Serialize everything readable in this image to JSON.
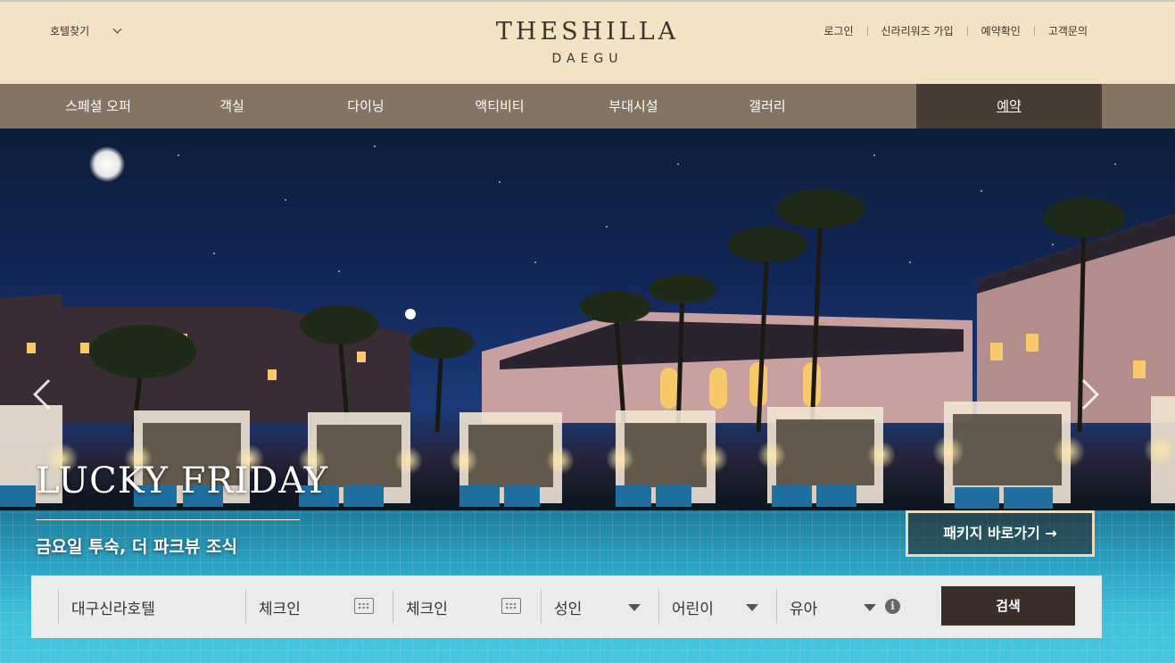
{
  "header": {
    "hotel_find": "호텔찾기",
    "logo_main": "THESHILLA",
    "logo_sub": "DAEGU",
    "util_links": [
      "로그인",
      "신라리워즈 가입",
      "예약확인",
      "고객문의"
    ]
  },
  "nav": {
    "items": [
      "스페셜 오퍼",
      "객실",
      "다이닝",
      "액티비티",
      "부대시설",
      "갤러리"
    ],
    "reserve": "예약"
  },
  "hero": {
    "promo_title": "LUCKY FRIDAY",
    "promo_subtitle": "금요일 투숙, 더 파크뷰 조식",
    "promo_button": "패키지 바로가기 →"
  },
  "booking": {
    "hotel": "대구신라호텔",
    "checkin": "체크인",
    "checkout": "체크인",
    "adults": "성인",
    "children": "어린이",
    "infants": "유아",
    "search": "검색"
  },
  "colors": {
    "header_bg": "#f2e3c5",
    "nav_bg": "#847463",
    "reserve_bg": "#463c33",
    "search_bg": "#3a2d2a"
  }
}
